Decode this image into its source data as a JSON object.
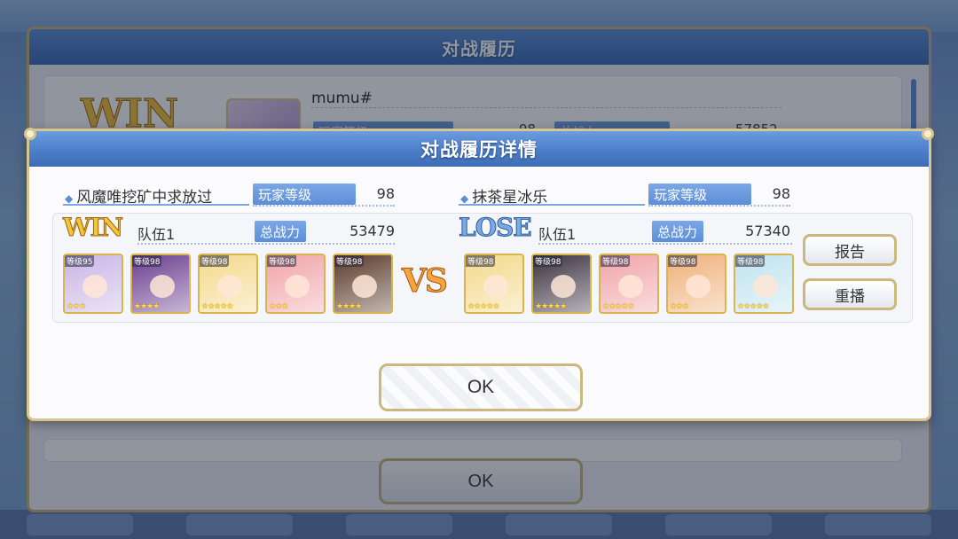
{
  "back_dialog": {
    "title": "对战履历",
    "result": "WIN",
    "player_name": "mumu#",
    "level_label": "玩家等级",
    "level_value": "98",
    "power_label": "总战力",
    "power_value": "57852",
    "ok_label": "OK"
  },
  "dialog": {
    "title": "对战履历详情",
    "ok_label": "OK",
    "report_label": "报告",
    "replay_label": "重播",
    "vs_label": "VS"
  },
  "left_player": {
    "name": "风魔唯挖矿中求放过",
    "level_label": "玩家等级",
    "level_value": "98",
    "result": "WIN",
    "team_label": "队伍1",
    "power_label": "总战力",
    "power_value": "53479",
    "units": [
      {
        "level": "等级95",
        "stars": "★★★",
        "color": "#c9b4e6"
      },
      {
        "level": "等级98",
        "stars": "★★★★",
        "color": "#6a3d8f"
      },
      {
        "level": "等级98",
        "stars": "★★★★★",
        "color": "#f3d98a"
      },
      {
        "level": "等级98",
        "stars": "★★★",
        "color": "#f1a3a8"
      },
      {
        "level": "等级98",
        "stars": "★★★★",
        "color": "#5a3a2a"
      }
    ]
  },
  "right_player": {
    "name": "抹茶星冰乐",
    "level_label": "玩家等级",
    "level_value": "98",
    "result": "LOSE",
    "team_label": "队伍1",
    "power_label": "总战力",
    "power_value": "57340",
    "units": [
      {
        "level": "等级98",
        "stars": "★★★★★",
        "color": "#f3d98a"
      },
      {
        "level": "等级98",
        "stars": "★★★★★",
        "color": "#3a3240"
      },
      {
        "level": "等级98",
        "stars": "★★★★★",
        "color": "#f1a3a8"
      },
      {
        "level": "等级98",
        "stars": "★★★",
        "color": "#f0b07a"
      },
      {
        "level": "等级98",
        "stars": "★★★★★",
        "color": "#bfe3ef"
      }
    ]
  }
}
